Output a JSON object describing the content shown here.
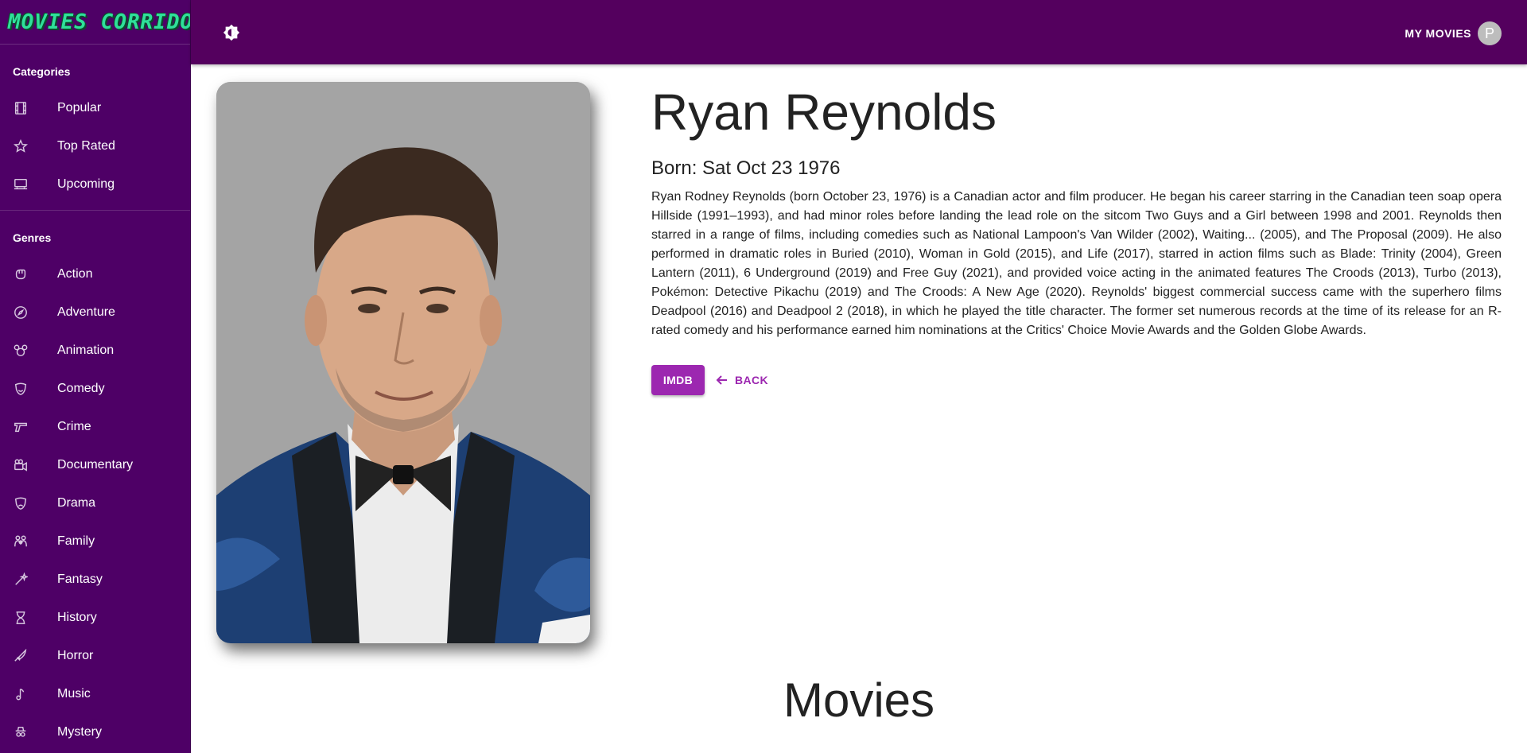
{
  "app": {
    "logo": "MOVIES CORRIDOR"
  },
  "sidebar": {
    "categories_heading": "Categories",
    "categories": [
      {
        "label": "Popular",
        "icon": "film-icon"
      },
      {
        "label": "Top Rated",
        "icon": "star-icon"
      },
      {
        "label": "Upcoming",
        "icon": "screen-icon"
      }
    ],
    "genres_heading": "Genres",
    "genres": [
      {
        "label": "Action",
        "icon": "fist-icon"
      },
      {
        "label": "Adventure",
        "icon": "compass-icon"
      },
      {
        "label": "Animation",
        "icon": "mouse-ears-icon"
      },
      {
        "label": "Comedy",
        "icon": "mask-icon"
      },
      {
        "label": "Crime",
        "icon": "pistol-icon"
      },
      {
        "label": "Documentary",
        "icon": "camera-icon"
      },
      {
        "label": "Drama",
        "icon": "drama-mask-icon"
      },
      {
        "label": "Family",
        "icon": "family-icon"
      },
      {
        "label": "Fantasy",
        "icon": "wand-icon"
      },
      {
        "label": "History",
        "icon": "hourglass-icon"
      },
      {
        "label": "Horror",
        "icon": "knife-icon"
      },
      {
        "label": "Music",
        "icon": "music-note-icon"
      },
      {
        "label": "Mystery",
        "icon": "detective-icon"
      }
    ]
  },
  "header": {
    "my_movies": "MY MOVIES",
    "avatar_initial": "P",
    "theme_icon": "brightness-icon"
  },
  "person": {
    "name": "Ryan Reynolds",
    "born": "Born: Sat Oct 23 1976",
    "bio": "Ryan Rodney Reynolds (born October 23, 1976) is a Canadian actor and film producer. He began his career starring in the Canadian teen soap opera Hillside (1991–1993), and had minor roles before landing the lead role on the sitcom Two Guys and a Girl between 1998 and 2001. Reynolds then starred in a range of films, including comedies such as National Lampoon's Van Wilder (2002), Waiting... (2005), and The Proposal (2009). He also performed in dramatic roles in Buried (2010), Woman in Gold (2015), and Life (2017), starred in action films such as Blade: Trinity (2004), Green Lantern (2011), 6 Underground (2019) and Free Guy (2021), and provided voice acting in the animated features The Croods (2013), Turbo (2013), Pokémon: Detective Pikachu (2019) and The Croods: A New Age (2020). Reynolds' biggest commercial success came with the superhero films Deadpool (2016) and Deadpool 2 (2018), in which he played the title character. The former set numerous records at the time of its release for an R-rated comedy and his performance earned him nominations at the Critics' Choice Movie Awards and the Golden Globe Awards."
  },
  "actions": {
    "imdb": "IMDB",
    "back": "BACK"
  },
  "movies_heading": "Movies",
  "colors": {
    "sidebar": "#4e0066",
    "topbar": "#54005e",
    "accent": "#9c27b0"
  }
}
